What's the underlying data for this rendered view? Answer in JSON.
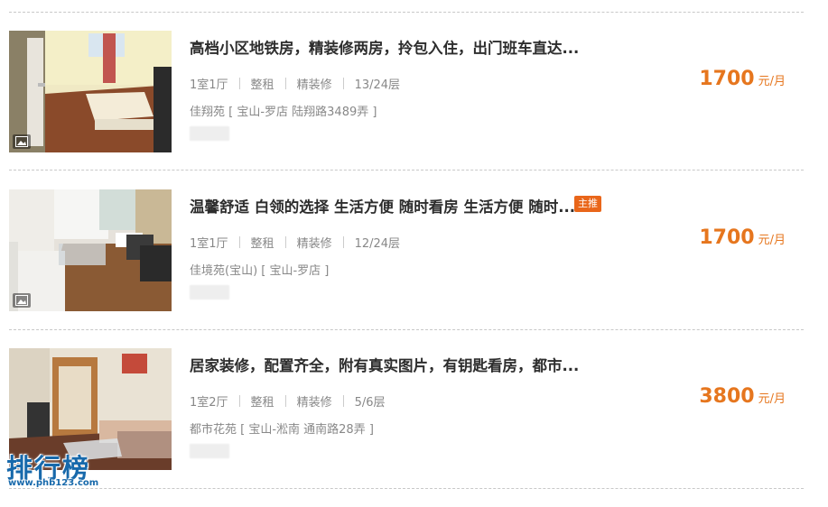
{
  "listings": [
    {
      "title": "高档小区地铁房，精装修两房，拎包入住，出门班车直达...",
      "rooms": "1室1厅",
      "rent_type": "整租",
      "decoration": "精装修",
      "floor": "13/24层",
      "location": "佳翔苑 [ 宝山-罗店 陆翔路3489弄 ]",
      "price": "1700",
      "unit": "元/月",
      "badge": ""
    },
    {
      "title": "温馨舒适 白领的选择 生活方便 随时看房 生活方便 随时...",
      "rooms": "1室1厅",
      "rent_type": "整租",
      "decoration": "精装修",
      "floor": "12/24层",
      "location": "佳境苑(宝山) [ 宝山-罗店 ]",
      "price": "1700",
      "unit": "元/月",
      "badge": "主推"
    },
    {
      "title": "居家装修，配置齐全，附有真实图片，有钥匙看房，都市...",
      "rooms": "1室2厅",
      "rent_type": "整租",
      "decoration": "精装修",
      "floor": "5/6层",
      "location": "都市花苑 [ 宝山-淞南 通南路28弄 ]",
      "price": "3800",
      "unit": "元/月",
      "badge": ""
    }
  ],
  "watermark": {
    "main": "排行榜",
    "url": "www.phb123.com"
  },
  "colors": {
    "price": "#e6761e",
    "badge": "#e9661a",
    "watermark": "#1769ab"
  }
}
